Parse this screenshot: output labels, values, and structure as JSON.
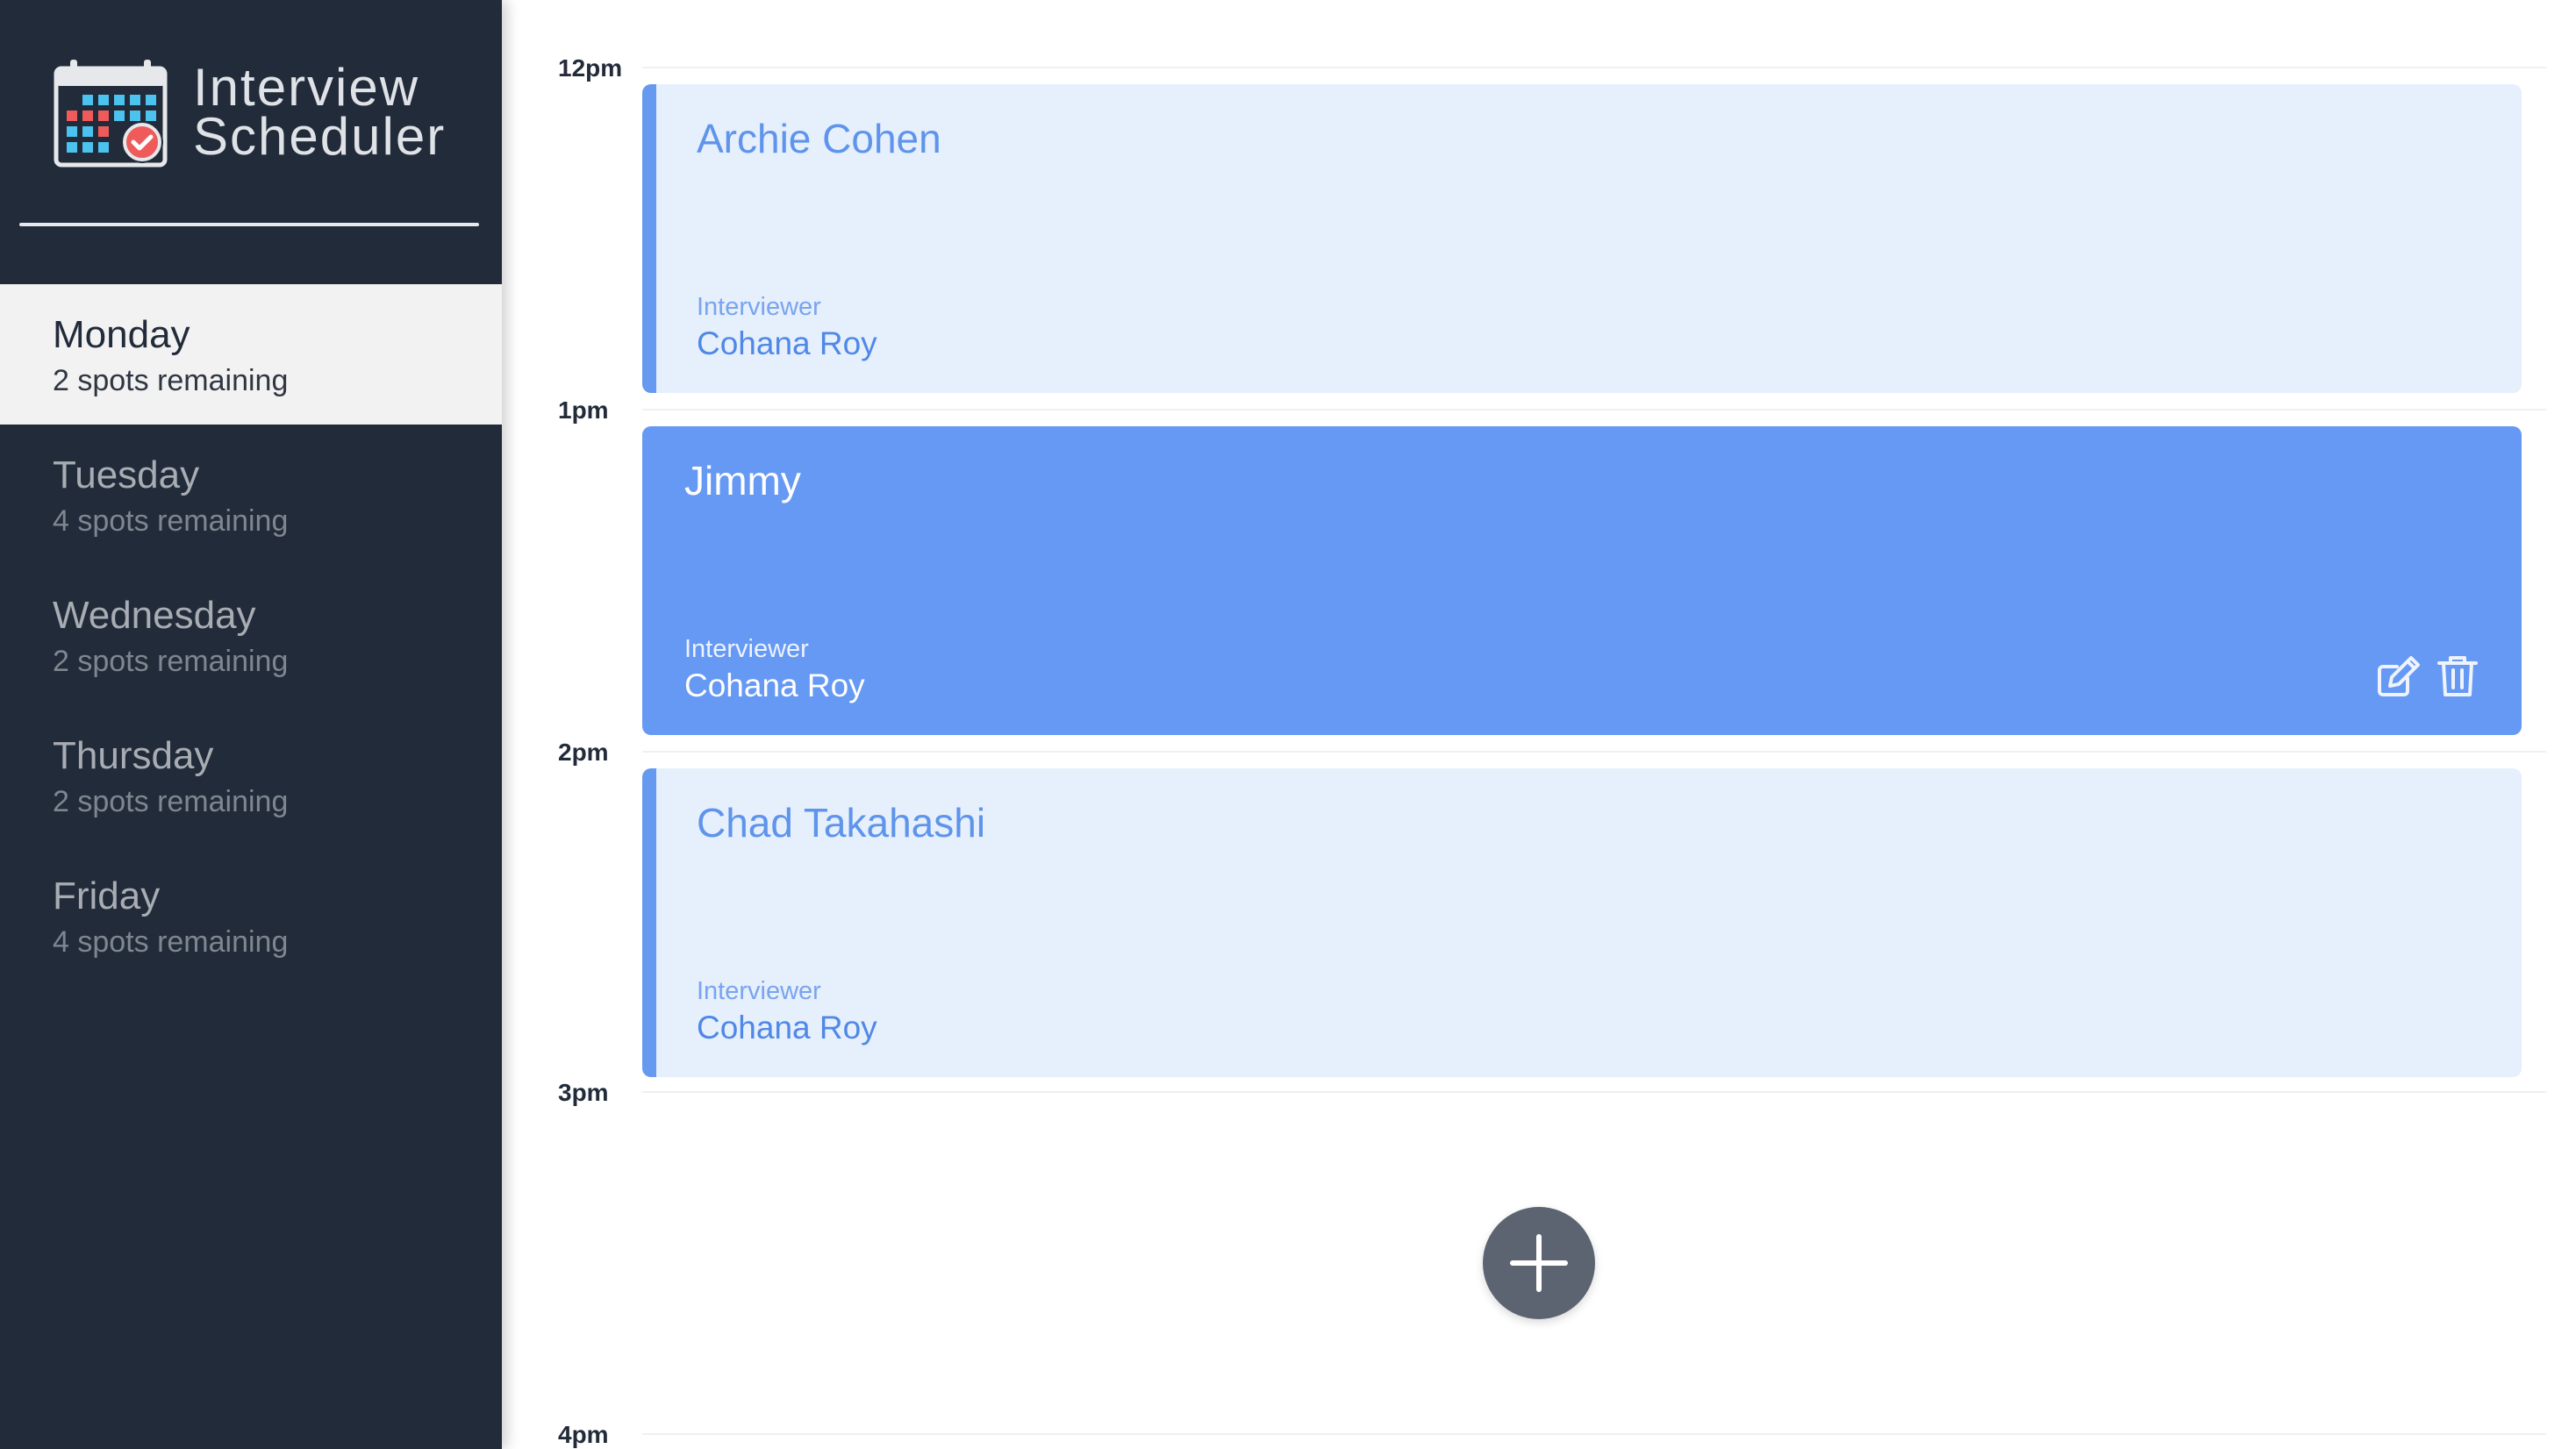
{
  "app": {
    "title": "Interview\nScheduler",
    "logo_icon": "calendar-check-icon"
  },
  "days": [
    {
      "name": "Monday",
      "spots": "2 spots remaining",
      "selected": true
    },
    {
      "name": "Tuesday",
      "spots": "4 spots remaining",
      "selected": false
    },
    {
      "name": "Wednesday",
      "spots": "2 spots remaining",
      "selected": false
    },
    {
      "name": "Thursday",
      "spots": "2 spots remaining",
      "selected": false
    },
    {
      "name": "Friday",
      "spots": "4 spots remaining",
      "selected": false
    }
  ],
  "times": [
    "12pm",
    "1pm",
    "2pm",
    "3pm",
    "4pm"
  ],
  "appointments": [
    {
      "student": "Archie Cohen",
      "interviewer_label": "Interviewer",
      "interviewer": "Cohana Roy",
      "hovered": false
    },
    {
      "student": "Jimmy",
      "interviewer_label": "Interviewer",
      "interviewer": "Cohana Roy",
      "hovered": true,
      "actions": [
        "edit-icon",
        "trash-icon"
      ]
    },
    {
      "student": "Chad Takahashi",
      "interviewer_label": "Interviewer",
      "interviewer": "Cohana Roy",
      "hovered": false
    }
  ],
  "add_button": {
    "icon": "plus-icon"
  },
  "colors": {
    "sidebar_bg": "#222b3a",
    "selected_day_bg": "#f2f2f2",
    "appointment_light_bg": "#e6effc",
    "appointment_accent": "#6699f0",
    "appointment_hover_bg": "#6599f4",
    "add_button_bg": "#5d6471"
  }
}
